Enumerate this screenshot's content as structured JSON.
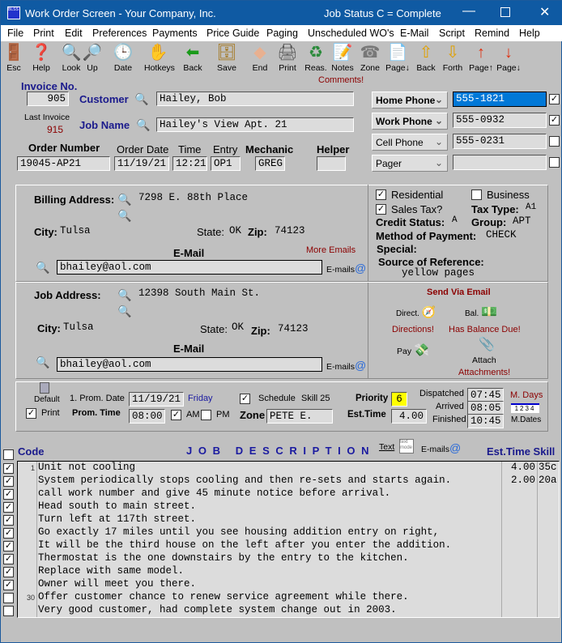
{
  "window": {
    "title": "Work Order Screen - Your Company, Inc.",
    "status": "Job Status  C = Complete",
    "logo": "BLSS"
  },
  "menu": [
    "File",
    "Print",
    "Edit",
    "Preferences",
    "Payments",
    "Price Guide",
    "Paging",
    "Unscheduled WO's",
    "E-Mail",
    "Script",
    "Remind",
    "Help"
  ],
  "toolbar": [
    {
      "label": "Esc",
      "icon": "door-exit-icon",
      "glyph": "🚪"
    },
    {
      "label": "Help",
      "icon": "help-book-icon",
      "glyph": "❓"
    },
    {
      "label": "Look",
      "icon": "look-magnifier-icon",
      "glyph": "🔍"
    },
    {
      "label": "Up",
      "icon": "up-magnifier-icon",
      "glyph": "🔎"
    },
    {
      "label": "Date",
      "icon": "calendar-clock-icon",
      "glyph": "🕒"
    },
    {
      "label": "Hotkeys",
      "icon": "hotkeys-hand-icon",
      "glyph": "✋"
    },
    {
      "label": "Back",
      "icon": "back-arrow-icon",
      "glyph": "⬅"
    },
    {
      "label": "Save",
      "icon": "safe-icon",
      "glyph": "🗄"
    },
    {
      "label": "End",
      "icon": "end-eraser-icon",
      "glyph": "◆"
    },
    {
      "label": "Print",
      "icon": "printer-icon",
      "glyph": "🖨"
    },
    {
      "label": "Reas.",
      "icon": "reasons-cycle-icon",
      "glyph": "♻"
    },
    {
      "label": "Notes",
      "icon": "notes-pad-icon",
      "glyph": "📝"
    },
    {
      "label": "Zone",
      "icon": "phone-icon",
      "glyph": "☎"
    },
    {
      "label": "Page↓",
      "icon": "page-down-icon",
      "glyph": "📄"
    },
    {
      "label": "Back",
      "icon": "sort-back-icon",
      "glyph": "⇧"
    },
    {
      "label": "Forth",
      "icon": "sort-forth-icon",
      "glyph": "⇩"
    },
    {
      "label": "Page↑",
      "icon": "sort-az-up-icon",
      "glyph": "↑"
    },
    {
      "label": "Page↓",
      "icon": "sort-az-down-icon",
      "glyph": "↓"
    }
  ],
  "comments_link": "Comments!",
  "header": {
    "invoice_label": "Invoice No.",
    "invoice": "905",
    "customer_label": "Customer",
    "customer": "Hailey, Bob",
    "last_invoice_label": "Last Invoice",
    "last_invoice": "915",
    "job_name_label": "Job Name",
    "job_name": "Hailey's View Apt. 21",
    "order_number_label": "Order Number",
    "order_number": "19045-AP21",
    "order_date_label": "Order Date",
    "order_date": "11/19/21",
    "time_label": "Time",
    "time": "12:21",
    "entry_label": "Entry",
    "entry": "OP1",
    "mechanic_label": "Mechanic",
    "mechanic": "GREG",
    "helper_label": "Helper",
    "helper": ""
  },
  "phones": [
    {
      "type": "Home Phone",
      "value": "555-1821",
      "checked": true
    },
    {
      "type": "Work Phone",
      "value": "555-0932",
      "checked": true
    },
    {
      "type": "Cell Phone",
      "value": "555-0231",
      "checked": false
    },
    {
      "type": "Pager",
      "value": "",
      "checked": false
    }
  ],
  "billing": {
    "label": "Billing Address:",
    "address": "7298 E. 88th Place",
    "city_label": "City:",
    "city": "Tulsa",
    "state_label": "State:",
    "state": "OK",
    "zip_label": "Zip:",
    "zip": "74123",
    "email_label": "E-Mail",
    "email": "bhailey@aol.com",
    "more_emails": "More Emails",
    "emails_button": "E-mails"
  },
  "account": {
    "residential": "Residential",
    "residential_checked": true,
    "business": "Business",
    "business_checked": false,
    "sales_tax": "Sales Tax?",
    "sales_tax_checked": true,
    "tax_type_label": "Tax Type:",
    "tax_type": "A1",
    "credit_label": "Credit Status:",
    "credit": "A",
    "group_label": "Group:",
    "group": "APT",
    "payment_label": "Method of Payment:",
    "payment": "CHECK",
    "special_label": "Special:",
    "source_label": "Source of Reference:",
    "source": "yellow pages"
  },
  "job_address": {
    "label": "Job Address:",
    "address": "12398 South Main St.",
    "city_label": "City:",
    "city": "Tulsa",
    "state_label": "State:",
    "state": "OK",
    "zip_label": "Zip:",
    "zip": "74123",
    "email_label": "E-Mail",
    "email": "bhailey@aol.com",
    "emails_button": "E-mails"
  },
  "send_email": {
    "title": "Send Via Email",
    "direct": "Direct.",
    "bal": "Bal.",
    "directions": "Directions!",
    "balance": "Has Balance Due!",
    "pay": "Pay",
    "attach": "Attach",
    "attachments": "Attachments!"
  },
  "schedule": {
    "default": "Default",
    "print": "Print",
    "print_checked": true,
    "prom_date_label": "1. Prom. Date",
    "prom_date": "11/19/21",
    "day": "Friday",
    "prom_time_label": "Prom. Time",
    "prom_time": "08:00",
    "am": "AM",
    "am_checked": true,
    "pm": "PM",
    "pm_checked": false,
    "schedule": "Schedule",
    "schedule_checked": true,
    "skill": "Skill 25",
    "zone_label": "Zone",
    "zone": "PETE E.",
    "priority_label": "Priority",
    "priority": "6",
    "est_time_label": "Est.Time",
    "est_time": "4.00",
    "dispatched_label": "Dispatched",
    "dispatched": "07:45",
    "arrived_label": "Arrived",
    "arrived": "08:05",
    "finished_label": "Finished",
    "finished": "10:45",
    "m_days": "M. Days",
    "m_dates": "M.Dates",
    "m_dates_icon": "1234"
  },
  "job_desc": {
    "code_label": "Code",
    "title": "J O B   D E S C R I P T I O N",
    "text_label": "Text",
    "text_mode": "text mode",
    "emails": "E-mails",
    "est_skill_label": "Est.Time Skill",
    "lines": [
      {
        "checked": true,
        "code": "1",
        "text": "Unit not cooling",
        "est": "4.00",
        "skill": "35c"
      },
      {
        "checked": true,
        "code": "",
        "text": "System periodically stops cooling and then re-sets and starts again.",
        "est": "2.00",
        "skill": "20a"
      },
      {
        "checked": true,
        "code": "",
        "text": "call work number and give 45 minute notice before arrival.",
        "est": "",
        "skill": ""
      },
      {
        "checked": true,
        "code": "",
        "text": "Head south to main street.",
        "est": "",
        "skill": ""
      },
      {
        "checked": true,
        "code": "",
        "text": "Turn left at 117th street.",
        "est": "",
        "skill": ""
      },
      {
        "checked": true,
        "code": "",
        "text": "Go exactly 17 miles until you see housing addition entry on right,",
        "est": "",
        "skill": ""
      },
      {
        "checked": true,
        "code": "",
        "text": "It will be the third house on the left after you enter the addition.",
        "est": "",
        "skill": ""
      },
      {
        "checked": true,
        "code": "",
        "text": "Thermostat is the one downstairs by the entry to the kitchen.",
        "est": "",
        "skill": ""
      },
      {
        "checked": true,
        "code": "",
        "text": "Replace with same model.",
        "est": "",
        "skill": ""
      },
      {
        "checked": true,
        "code": "",
        "text": "Owner will meet you there.",
        "est": "",
        "skill": ""
      },
      {
        "checked": false,
        "code": "30",
        "text": "Offer customer chance to renew service agreement while there.",
        "est": "",
        "skill": ""
      },
      {
        "checked": false,
        "code": "",
        "text": "Very good customer, had complete system change out in 2003.",
        "est": "",
        "skill": ""
      }
    ]
  },
  "colors": {
    "titlebar": "#0f5aa3",
    "selected_field": "#0078d7",
    "priority": "#ffff00",
    "alert": "#8b0000",
    "label": "#1a1a8c"
  }
}
